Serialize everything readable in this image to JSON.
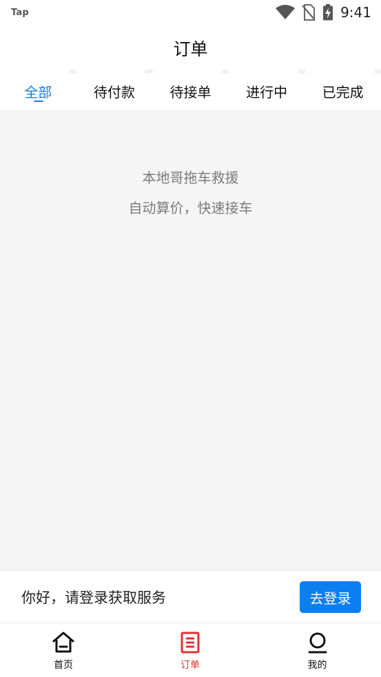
{
  "status_bar": {
    "app_label": "Tap",
    "time": "9:41",
    "icons": [
      "wifi-icon",
      "no-sim-icon",
      "battery-charging-icon"
    ]
  },
  "header": {
    "title": "订单"
  },
  "tabs": [
    {
      "label": "全部",
      "active": true
    },
    {
      "label": "待付款",
      "active": false
    },
    {
      "label": "待接单",
      "active": false
    },
    {
      "label": "进行中",
      "active": false
    },
    {
      "label": "已完成",
      "active": false
    }
  ],
  "empty_state": {
    "line1": "本地哥拖车救援",
    "line2": "自动算价，快速接车"
  },
  "login_bar": {
    "prompt": "你好，请登录获取服务",
    "button_label": "去登录"
  },
  "bottom_nav": [
    {
      "label": "首页",
      "icon": "home-icon",
      "active": false
    },
    {
      "label": "订单",
      "icon": "order-list-icon",
      "active": true
    },
    {
      "label": "我的",
      "icon": "profile-icon",
      "active": false
    }
  ],
  "colors": {
    "accent_blue": "#1a7be0",
    "button_blue": "#0b7ef0",
    "active_nav_red": "#e03131",
    "content_bg": "#f5f5f5",
    "muted_text": "#7a7a7a"
  }
}
